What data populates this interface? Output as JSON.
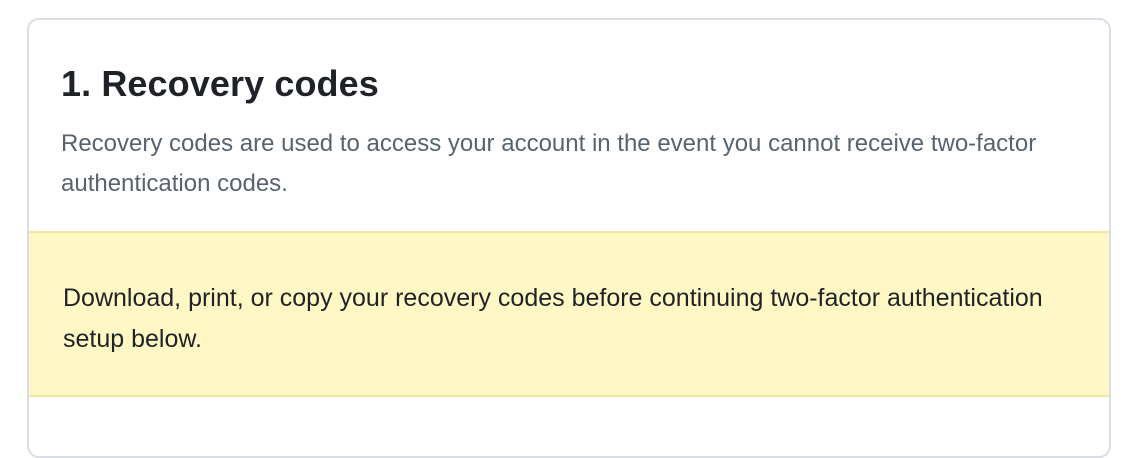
{
  "recovery_codes_section": {
    "title": "1. Recovery codes",
    "description": "Recovery codes are used to access your account in the event you cannot receive two-factor authentication codes."
  },
  "warning": {
    "text": "Download, print, or copy your recovery codes before continuing two-factor authentication setup below."
  },
  "colors": {
    "warning_background": "#fff8c5",
    "warning_border": "#f0e6a6",
    "card_border": "#d8dee4",
    "title_text": "#1f2328",
    "muted_text": "#59636e"
  }
}
